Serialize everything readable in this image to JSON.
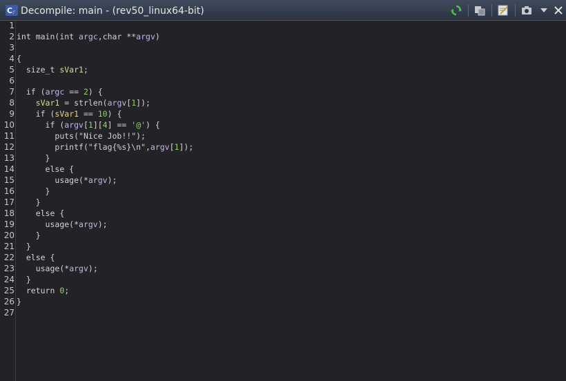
{
  "window": {
    "title": "Decompile: main -  (rev50_linux64-bit)",
    "icons": [
      "decompile-c-icon",
      "refresh-icon",
      "copy-icon",
      "edit-icon",
      "snapshot-icon",
      "dropdown-icon",
      "close-icon"
    ]
  },
  "colors": {
    "title_bg": "#2b3341",
    "editor_bg": "#222326",
    "parameter": "#c8b2e6",
    "local_var": "#e4d48a",
    "number": "#8fd26b"
  },
  "code_lines": [
    {
      "n": "1",
      "tokens": []
    },
    {
      "n": "2",
      "tokens": [
        [
          "type",
          "int "
        ],
        [
          "fn",
          "main"
        ],
        [
          "plain",
          "("
        ],
        [
          "type",
          "int "
        ],
        [
          "var",
          "argc"
        ],
        [
          "plain",
          ","
        ],
        [
          "type",
          "char "
        ],
        [
          "plain",
          "**"
        ],
        [
          "var",
          "argv"
        ],
        [
          "plain",
          ")"
        ]
      ]
    },
    {
      "n": "3",
      "tokens": []
    },
    {
      "n": "4",
      "tokens": [
        [
          "plain",
          "{"
        ]
      ]
    },
    {
      "n": "5",
      "tokens": [
        [
          "plain",
          "  "
        ],
        [
          "type",
          "size_t "
        ],
        [
          "local",
          "sVar1"
        ],
        [
          "plain",
          ";"
        ]
      ]
    },
    {
      "n": "6",
      "tokens": []
    },
    {
      "n": "7",
      "tokens": [
        [
          "plain",
          "  "
        ],
        [
          "kw",
          "if "
        ],
        [
          "plain",
          "("
        ],
        [
          "var",
          "argc"
        ],
        [
          "plain",
          " == "
        ],
        [
          "num",
          "2"
        ],
        [
          "plain",
          ") {"
        ]
      ]
    },
    {
      "n": "8",
      "tokens": [
        [
          "plain",
          "    "
        ],
        [
          "local",
          "sVar1"
        ],
        [
          "plain",
          " = "
        ],
        [
          "fn",
          "strlen"
        ],
        [
          "plain",
          "("
        ],
        [
          "var",
          "argv"
        ],
        [
          "plain",
          "["
        ],
        [
          "num",
          "1"
        ],
        [
          "plain",
          "]);"
        ]
      ]
    },
    {
      "n": "9",
      "tokens": [
        [
          "plain",
          "    "
        ],
        [
          "kw",
          "if "
        ],
        [
          "plain",
          "("
        ],
        [
          "local",
          "sVar1"
        ],
        [
          "plain",
          " == "
        ],
        [
          "num",
          "10"
        ],
        [
          "plain",
          ") {"
        ]
      ]
    },
    {
      "n": "10",
      "tokens": [
        [
          "plain",
          "      "
        ],
        [
          "kw",
          "if "
        ],
        [
          "plain",
          "("
        ],
        [
          "var",
          "argv"
        ],
        [
          "plain",
          "["
        ],
        [
          "num",
          "1"
        ],
        [
          "plain",
          "]["
        ],
        [
          "num",
          "4"
        ],
        [
          "plain",
          "] == "
        ],
        [
          "char",
          "'@'"
        ],
        [
          "plain",
          ") {"
        ]
      ]
    },
    {
      "n": "11",
      "tokens": [
        [
          "plain",
          "        "
        ],
        [
          "fn",
          "puts"
        ],
        [
          "plain",
          "("
        ],
        [
          "str",
          "\"Nice Job!!\""
        ],
        [
          "plain",
          ");"
        ]
      ]
    },
    {
      "n": "12",
      "tokens": [
        [
          "plain",
          "        "
        ],
        [
          "fn",
          "printf"
        ],
        [
          "plain",
          "("
        ],
        [
          "str",
          "\"flag{%s}\\n\""
        ],
        [
          "plain",
          ","
        ],
        [
          "var",
          "argv"
        ],
        [
          "plain",
          "["
        ],
        [
          "num",
          "1"
        ],
        [
          "plain",
          "]);"
        ]
      ]
    },
    {
      "n": "13",
      "tokens": [
        [
          "plain",
          "      }"
        ]
      ]
    },
    {
      "n": "14",
      "tokens": [
        [
          "plain",
          "      "
        ],
        [
          "kw",
          "else "
        ],
        [
          "plain",
          "{"
        ]
      ]
    },
    {
      "n": "15",
      "tokens": [
        [
          "plain",
          "        "
        ],
        [
          "fn",
          "usage"
        ],
        [
          "plain",
          "(*"
        ],
        [
          "var",
          "argv"
        ],
        [
          "plain",
          ");"
        ]
      ]
    },
    {
      "n": "16",
      "tokens": [
        [
          "plain",
          "      }"
        ]
      ]
    },
    {
      "n": "17",
      "tokens": [
        [
          "plain",
          "    }"
        ]
      ]
    },
    {
      "n": "18",
      "tokens": [
        [
          "plain",
          "    "
        ],
        [
          "kw",
          "else "
        ],
        [
          "plain",
          "{"
        ]
      ]
    },
    {
      "n": "19",
      "tokens": [
        [
          "plain",
          "      "
        ],
        [
          "fn",
          "usage"
        ],
        [
          "plain",
          "(*"
        ],
        [
          "var",
          "argv"
        ],
        [
          "plain",
          ");"
        ]
      ]
    },
    {
      "n": "20",
      "tokens": [
        [
          "plain",
          "    }"
        ]
      ]
    },
    {
      "n": "21",
      "tokens": [
        [
          "plain",
          "  }"
        ]
      ]
    },
    {
      "n": "22",
      "tokens": [
        [
          "plain",
          "  "
        ],
        [
          "kw",
          "else "
        ],
        [
          "plain",
          "{"
        ]
      ]
    },
    {
      "n": "23",
      "tokens": [
        [
          "plain",
          "    "
        ],
        [
          "fn",
          "usage"
        ],
        [
          "plain",
          "(*"
        ],
        [
          "var",
          "argv"
        ],
        [
          "plain",
          ");"
        ]
      ]
    },
    {
      "n": "24",
      "tokens": [
        [
          "plain",
          "  }"
        ]
      ]
    },
    {
      "n": "25",
      "tokens": [
        [
          "plain",
          "  "
        ],
        [
          "kw",
          "return "
        ],
        [
          "num",
          "0"
        ],
        [
          "plain",
          ";"
        ]
      ]
    },
    {
      "n": "26",
      "tokens": [
        [
          "plain",
          "}"
        ]
      ]
    },
    {
      "n": "27",
      "tokens": []
    }
  ]
}
